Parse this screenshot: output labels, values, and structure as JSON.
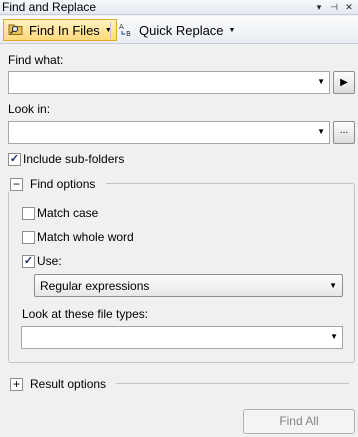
{
  "window": {
    "title": "Find and Replace",
    "controls": {
      "dropdown": "▾",
      "pin": "⊣",
      "close": "✕"
    }
  },
  "toolbar": {
    "find_in_files": "Find In Files",
    "quick_replace": "Quick Replace"
  },
  "find_what": {
    "label": "Find what:",
    "value": ""
  },
  "look_in": {
    "label": "Look in:",
    "value": "",
    "browse": "..."
  },
  "include_subfolders": {
    "label": "Include sub-folders",
    "checked": true
  },
  "find_options": {
    "label": "Find options",
    "match_case": {
      "label": "Match case",
      "checked": false
    },
    "match_whole_word": {
      "label": "Match whole word",
      "checked": false
    },
    "use": {
      "label": "Use:",
      "checked": true,
      "selected": "Regular expressions"
    },
    "file_types": {
      "label": "Look at these file types:",
      "value": ""
    }
  },
  "result_options": {
    "label": "Result options"
  },
  "find_all_label": "Find All"
}
